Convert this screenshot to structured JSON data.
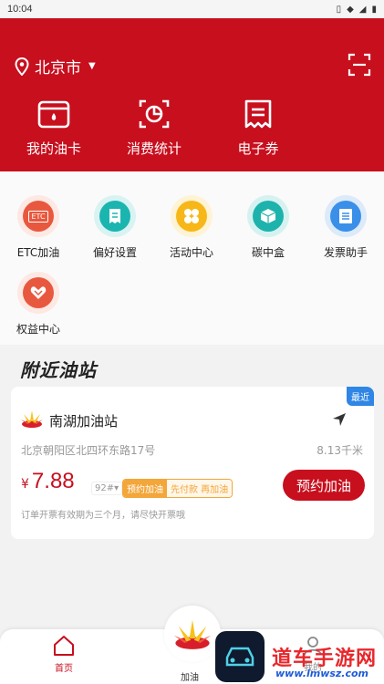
{
  "status_bar": {
    "time": "10:04"
  },
  "header": {
    "city": "北京市",
    "quick_actions": [
      {
        "label": "我的油卡",
        "icon": "wallet-icon"
      },
      {
        "label": "消费统计",
        "icon": "chart-icon"
      },
      {
        "label": "电子券",
        "icon": "coupon-icon"
      }
    ]
  },
  "services": [
    {
      "label": "ETC加油",
      "icon": "etc-icon",
      "icon_text": "ETC",
      "color": "#e8583e"
    },
    {
      "label": "偏好设置",
      "icon": "receipt-icon",
      "color": "#1bb5b0"
    },
    {
      "label": "活动中心",
      "icon": "clover-icon",
      "color": "#f7b718"
    },
    {
      "label": "碳中盒",
      "icon": "box-icon",
      "color": "#1db3ac"
    },
    {
      "label": "发票助手",
      "icon": "invoice-icon",
      "color": "#3a8fe8"
    },
    {
      "label": "权益中心",
      "icon": "heart-icon",
      "color": "#e8583e"
    }
  ],
  "nearby": {
    "title": "附近油站",
    "station": {
      "badge": "最近",
      "name": "南湖加油站",
      "address": "北京朝阳区北四环东路17号",
      "distance": "8.13千米",
      "currency": "¥",
      "price": "7.88",
      "fuel": "92#▾",
      "tag_reserve": "预约加油",
      "tag_prepay": "先付款 再加油",
      "reserve_button": "预约加油",
      "notice": "订单开票有效期为三个月，请尽快开票哦"
    }
  },
  "tabbar": {
    "home": "首页",
    "fuel": "加油",
    "mine": "我的"
  },
  "watermark": {
    "text": "道车手游网",
    "url": "www.lmwsz.com"
  }
}
